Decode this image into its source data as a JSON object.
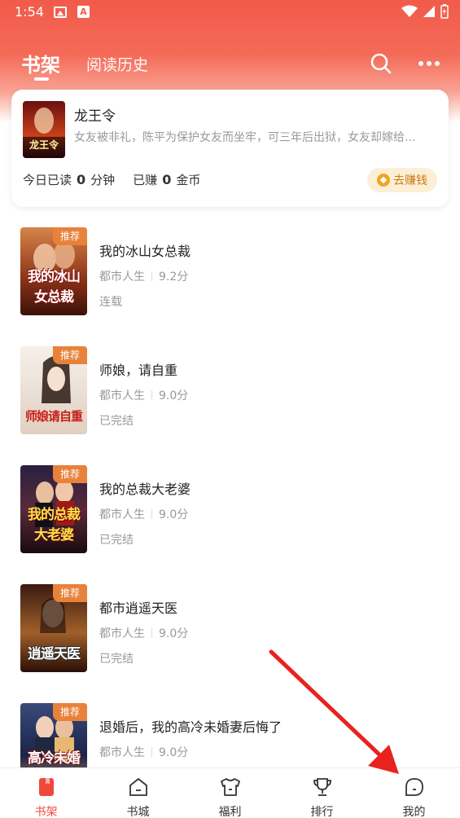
{
  "status": {
    "time": "1:54",
    "a_badge": "A"
  },
  "tabs": {
    "bookshelf": "书架",
    "history": "阅读历史"
  },
  "recent": {
    "title": "龙王令",
    "description": "女友被非礼，陈平为保护女友而坐牢，可三年后出狱，女友却嫁给...",
    "cover_text": "龙王令",
    "read_prefix": "今日已读",
    "read_minutes": "0",
    "read_unit": "分钟",
    "earned_prefix": "已赚",
    "earned_coins": "0",
    "earned_unit": "金币",
    "earn_button": "去赚钱"
  },
  "books": [
    {
      "badge": "推荐",
      "title": "我的冰山女总裁",
      "genre": "都市人生",
      "score": "9.2分",
      "status": "连载",
      "cover_text": "我的冰山女总裁",
      "cover_colors": [
        "#b5542a",
        "#4a1a0a"
      ]
    },
    {
      "badge": "推荐",
      "title": "师娘，请自重",
      "genre": "都市人生",
      "score": "9.0分",
      "status": "已完结",
      "cover_text": "师娘请自重",
      "cover_colors": [
        "#f3ece4",
        "#d6c3b0"
      ]
    },
    {
      "badge": "推荐",
      "title": "我的总裁大老婆",
      "genre": "都市人生",
      "score": "9.0分",
      "status": "已完结",
      "cover_text": "我的总裁大老婆",
      "cover_colors": [
        "#3a1e3e",
        "#a0302a"
      ]
    },
    {
      "badge": "推荐",
      "title": "都市逍遥天医",
      "genre": "都市人生",
      "score": "9.0分",
      "status": "已完结",
      "cover_text": "逍遥天医",
      "cover_colors": [
        "#5a2a1c",
        "#b8743a"
      ]
    },
    {
      "badge": "推荐",
      "title": "退婚后，我的高冷未婚妻后悔了",
      "genre": "都市人生",
      "score": "9.0分",
      "status": "",
      "cover_text": "高冷未婚",
      "cover_colors": [
        "#2a3a6a",
        "#c8a070"
      ]
    }
  ],
  "nav": [
    {
      "label": "书架",
      "icon": "bookshelf-icon",
      "active": true
    },
    {
      "label": "书城",
      "icon": "bookstore-icon",
      "active": false
    },
    {
      "label": "福利",
      "icon": "welfare-icon",
      "active": false
    },
    {
      "label": "排行",
      "icon": "trophy-icon",
      "active": false
    },
    {
      "label": "我的",
      "icon": "profile-icon",
      "active": false
    }
  ],
  "colors": {
    "brand": "#ee4a3c",
    "header_gradient_top": "#f25a4a",
    "badge": "#e8823a",
    "coin": "#f3a521",
    "annotation_arrow": "#e8231f"
  }
}
